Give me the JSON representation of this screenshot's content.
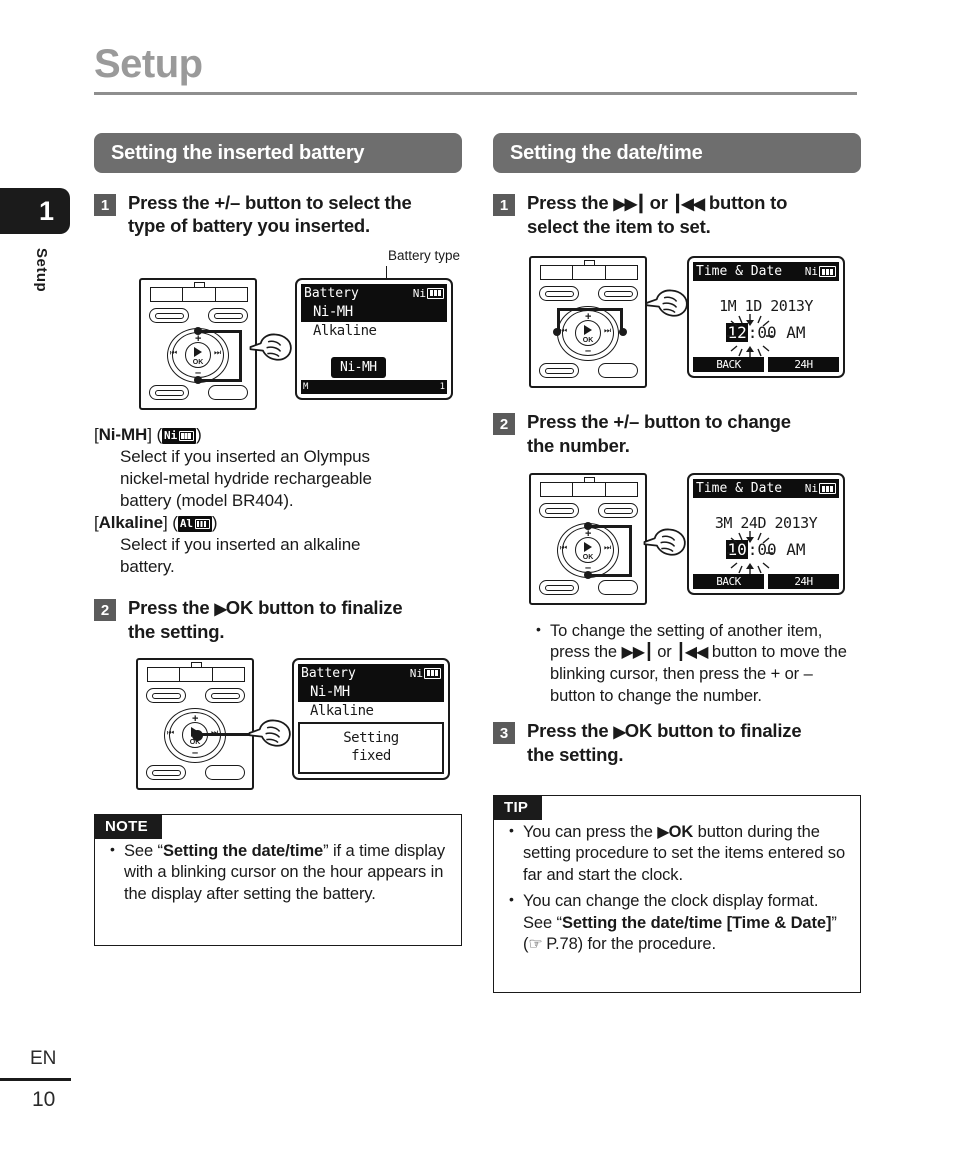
{
  "page": {
    "title": "Setup",
    "chapter_number": "1",
    "chapter_label": "Setup",
    "language_code": "EN",
    "page_number": "10",
    "accent_gray": "#6e6e6e",
    "title_gray": "#9a9a9a",
    "ink": "#1a1a1a"
  },
  "left_column": {
    "section_title": "Setting the inserted battery",
    "step1": {
      "num": "1",
      "text_part1": "Press the +/– button to select the",
      "text_part2": "type of battery you inserted."
    },
    "callout": "Battery type",
    "lcd1": {
      "title": "Battery",
      "battery_indicator": "Ni",
      "row_selected": "Ni-MH",
      "row_other": "Alkaline",
      "popup": "Ni-MH",
      "foot_left": "M",
      "foot_right": "1"
    },
    "options": {
      "ni_mh_label": "Ni-MH",
      "ni_mh_icon": "Ni",
      "ni_mh_desc_1": "Select if you inserted an Olympus",
      "ni_mh_desc_2": "nickel-metal hydride rechargeable",
      "ni_mh_desc_3": "battery (model BR404).",
      "alkaline_label": "Alkaline",
      "alkaline_icon": "Al",
      "alkaline_desc_1": "Select if you inserted an alkaline",
      "alkaline_desc_2": "battery."
    },
    "step2": {
      "num": "2",
      "text_before": "Press the",
      "ok_label": "OK",
      "text_after": " button to finalize",
      "text_part2": "the setting."
    },
    "lcd2": {
      "title": "Battery",
      "battery_indicator": "Ni",
      "row_selected": "Ni-MH",
      "row_other": "Alkaline",
      "panel_line1": "Setting",
      "panel_line2": "fixed"
    },
    "note": {
      "tag": "NOTE",
      "bullet_a": "See “",
      "bullet_b": "Setting the date/time",
      "bullet_c": "” if a time display with a blinking cursor on the hour appears in the display after setting the battery."
    }
  },
  "right_column": {
    "section_title": "Setting the date/time",
    "step1": {
      "num": "1",
      "text_before": "Press the",
      "text_or": "or",
      "text_after": "button to",
      "text_part2": "select the item to set."
    },
    "lcd1": {
      "title": "Time & Date",
      "battery_indicator": "Ni",
      "date": "1M  1D  2013Y",
      "hour": "12",
      "time_rest": ":00 AM",
      "softkey_left": "BACK",
      "softkey_right": "24H"
    },
    "step2": {
      "num": "2",
      "text_part1": "Press the +/– button to change",
      "text_part2": "the number."
    },
    "lcd2": {
      "title": "Time & Date",
      "battery_indicator": "Ni",
      "date": "3M 24D  2013Y",
      "hour": "10",
      "time_rest": ":00 AM",
      "softkey_left": "BACK",
      "softkey_right": "24H"
    },
    "bullet_change": {
      "a": "To change the setting of another item, press the",
      "b": "or",
      "c": "button to move the blinking cursor, then press the + or – button to change the number."
    },
    "step3": {
      "num": "3",
      "text_before": "Press the",
      "ok_label": "OK",
      "text_after": " button to finalize",
      "text_part2": "the setting."
    },
    "tip": {
      "tag": "TIP",
      "bullet1_a": "You can press the",
      "bullet1_ok": "OK",
      "bullet1_b": " button during the setting procedure to set the items entered so far and start the clock.",
      "bullet2_a": "You can change the clock display format. See “",
      "bullet2_b": "Setting the date/time",
      "bullet2_c": "[Time & Date]",
      "bullet2_d": "” (",
      "bullet2_ref": "P.78",
      "bullet2_e": ") for the procedure."
    }
  }
}
